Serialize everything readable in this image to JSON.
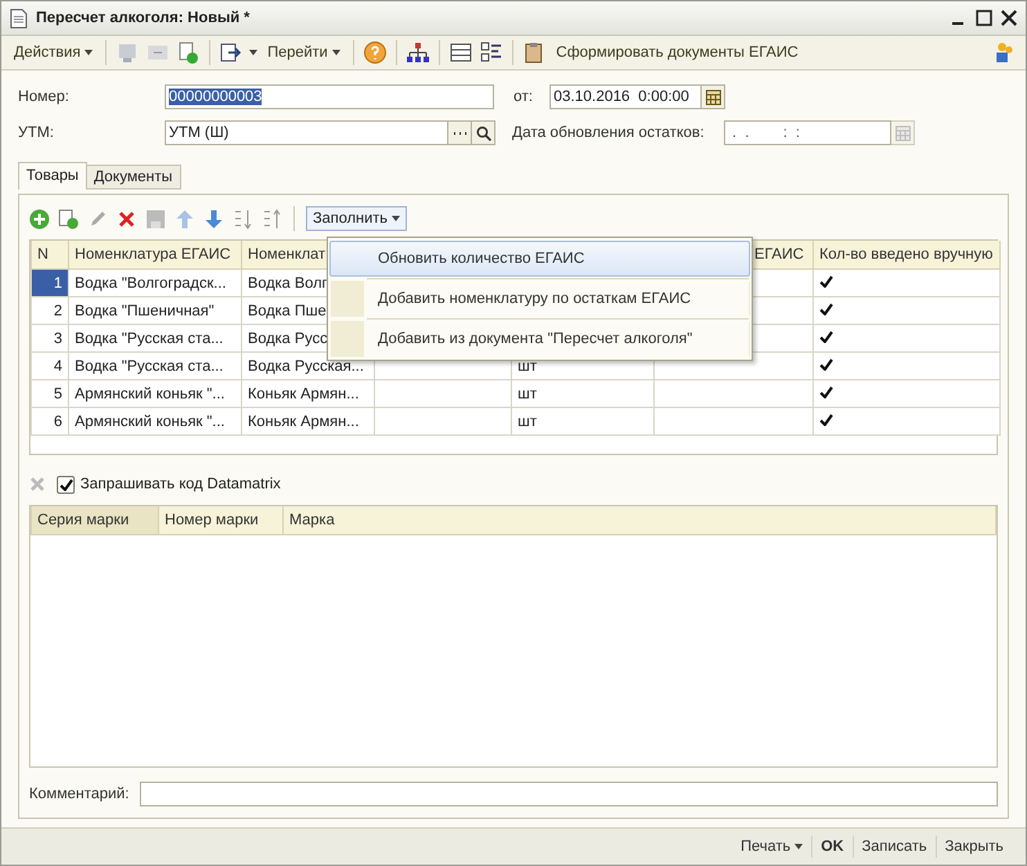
{
  "window": {
    "title": "Пересчет алкоголя: Новый *"
  },
  "toolbar": {
    "actions_menu": "Действия",
    "goto_menu": "Перейти",
    "egais_button": "Сформировать документы ЕГАИС"
  },
  "header": {
    "number": {
      "label": "Номер:",
      "value": "00000000003",
      "highlighted": true
    },
    "date": {
      "label": "от:",
      "value": "03.10.2016  0:00:00"
    },
    "utm": {
      "label": "УТМ:",
      "value": "УТМ (Ш)"
    },
    "stock_date": {
      "label": "Дата обновления остатков:",
      "value": " .  .        :  :"
    }
  },
  "tabs": [
    {
      "label": "Товары",
      "selected": true
    },
    {
      "label": "Документы",
      "selected": false
    }
  ],
  "goods": {
    "fill_menu": "Заполнить",
    "columns": [
      {
        "label": "N"
      },
      {
        "label": "Номенклатура ЕГАИС"
      },
      {
        "label": "Номенклат"
      },
      {},
      {},
      {
        "label": "ЕГАИС"
      },
      {
        "label": "Кол-во введено вручную"
      }
    ],
    "rows": [
      {
        "n": "1",
        "egais": "Водка \"Волгоградск...",
        "nomenclature": "Водка Волг",
        "manual": true,
        "selected": true
      },
      {
        "n": "2",
        "egais": "Водка \"Пшеничная\"",
        "nomenclature": "Водка Пше",
        "manual": true,
        "selected": false
      },
      {
        "n": "3",
        "egais": "Водка \"Русская ста...",
        "nomenclature": "Водка Русс",
        "manual": true,
        "selected": false
      },
      {
        "n": "4",
        "egais": "Водка \"Русская ста...",
        "nomenclature": "Водка Русская...",
        "unit": "шт",
        "manual": true,
        "selected": false
      },
      {
        "n": "5",
        "egais": "Армянский коньяк \"...",
        "nomenclature": "Коньяк Армян...",
        "unit": "шт",
        "manual": true,
        "selected": false
      },
      {
        "n": "6",
        "egais": "Армянский коньяк \"...",
        "nomenclature": "Коньяк Армян...",
        "unit": "шт",
        "manual": true,
        "selected": false
      }
    ],
    "fill_popup": [
      {
        "label": "Обновить количество ЕГАИС",
        "selected": true
      },
      {
        "label": "Добавить номенклатуру по остаткам ЕГАИС",
        "selected": false
      },
      {
        "label": "Добавить из документа \"Пересчет алкоголя\"",
        "selected": false
      }
    ]
  },
  "marks": {
    "datamatrix": {
      "label": "Запрашивать код Datamatrix",
      "checked": true
    },
    "columns": [
      {
        "label": "Серия марки",
        "selected": true
      },
      {
        "label": "Номер марки",
        "selected": false
      },
      {
        "label": "Марка",
        "selected": false
      }
    ]
  },
  "comment": {
    "label": "Комментарий:"
  },
  "footer": [
    {
      "label": "Печать",
      "kind": "menu"
    },
    {
      "label": "OK",
      "kind": "default"
    },
    {
      "label": "Записать",
      "kind": "plain"
    },
    {
      "label": "Закрыть",
      "kind": "plain"
    }
  ]
}
